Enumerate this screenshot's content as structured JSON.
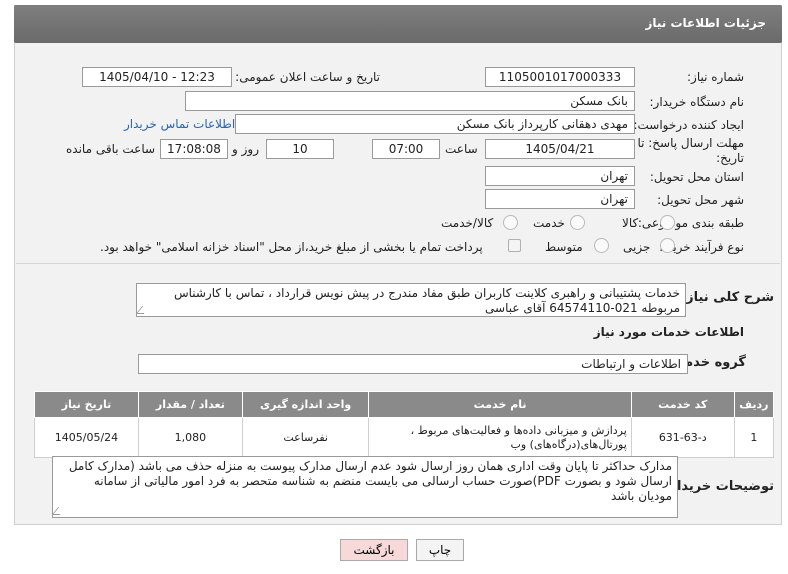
{
  "header": {
    "title": "جزئیات اطلاعات نیاز"
  },
  "form": {
    "need_number_label": "شماره نیاز:",
    "need_number": "1105001017000333",
    "announce_label": "تاریخ و ساعت اعلان عمومی:",
    "announce_value": "1405/04/10 - 12:23",
    "buyer_org_label": "نام دستگاه خریدار:",
    "buyer_org": "بانک مسکن",
    "requester_label": "ایجاد کننده درخواست:",
    "requester": "مهدی دهقانی کارپرداز بانک مسکن",
    "contact_link": "اطلاعات تماس خریدار",
    "deadline_label_1": "مهلت ارسال پاسخ: تا",
    "deadline_label_2": "تاریخ:",
    "deadline_date": "1405/04/21",
    "time_label": "ساعت",
    "deadline_time": "07:00",
    "days_value": "10",
    "days_label": "روز و",
    "remaining_time": "17:08:08",
    "remaining_label": "ساعت باقی مانده",
    "province_label": "استان محل تحویل:",
    "province": "تهران",
    "city_label": "شهر محل تحویل:",
    "city": "تهران",
    "category_label": "طبقه بندی موضوعی:",
    "category_options": [
      "کالا",
      "خدمت",
      "کالا/خدمت"
    ],
    "process_label": "نوع فرآیند خرید :",
    "process_options": [
      "جزیی",
      "متوسط"
    ],
    "payment_note": "پرداخت تمام یا بخشی از مبلغ خرید،از محل \"اسناد خزانه اسلامی\" خواهد بود."
  },
  "summary": {
    "label": "شرح کلی نیاز:",
    "text": "خدمات پشتیبانی و راهبری کلاینت کاربران طبق مفاد مندرج در پیش نویس قرارداد ، تماس با کارشناس مربوطه 021-64574110 آقای عباسی"
  },
  "services_section": {
    "title": "اطلاعات خدمات مورد نیاز",
    "group_label": "گروه خدمت:",
    "group_value": "اطلاعات و ارتباطات"
  },
  "table": {
    "headers": [
      "ردیف",
      "کد خدمت",
      "نام خدمت",
      "واحد اندازه گیری",
      "تعداد / مقدار",
      "تاریخ نیاز"
    ],
    "rows": [
      {
        "index": "1",
        "code": "د-63-631",
        "name": "پردازش و میزبانی داده‌ها و فعالیت‌های مربوط ، پورتال‌های(درگاه‌های) وب",
        "unit": "نفرساعت",
        "quantity": "1,080",
        "date": "1405/05/24"
      }
    ]
  },
  "notes": {
    "label": "توضیحات خریدار:",
    "text": "مدارک حداکثر تا پایان وقت اداری همان روز ارسال شود عدم ارسال مدارک پیوست به منزله حذف می باشد (مدارک کامل ارسال شود و بصورت PDF)صورت حساب ارسالی می بایست منضم به شناسه متحصر به فرد امور مالیاتی از سامانه مودیان باشد"
  },
  "buttons": {
    "print": "چاپ",
    "back": "بازگشت"
  },
  "colors": {
    "header": "#707070",
    "link": "#2a63b8",
    "table_header": "#8a8a8a",
    "back_button": "#f7d9d9"
  }
}
